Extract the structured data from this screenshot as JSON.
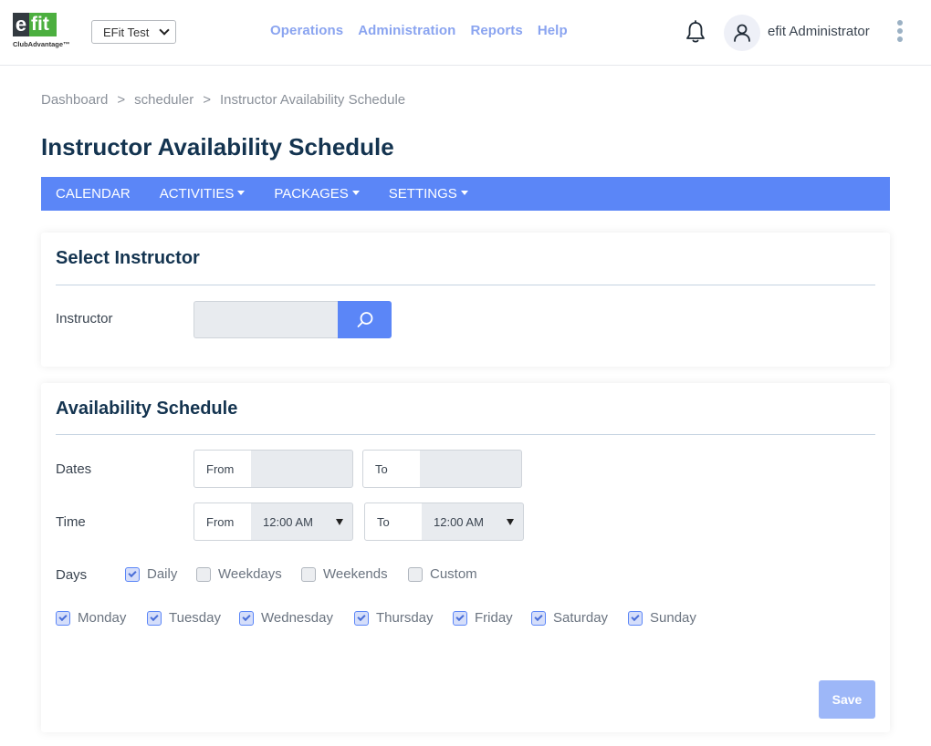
{
  "header": {
    "logo": {
      "mark_e": "e",
      "mark_fit": "fit",
      "subtitle": "ClubAdvantage™"
    },
    "club_select": {
      "value": "EFit Test"
    },
    "nav": [
      "Operations",
      "Administration",
      "Reports",
      "Help"
    ],
    "user_name": "efit Administrator",
    "icons": {
      "notifications": "bell-icon",
      "user": "user-icon",
      "more": "kebab-menu-icon"
    }
  },
  "breadcrumb": {
    "items": [
      "Dashboard",
      "scheduler",
      "Instructor Availability Schedule"
    ],
    "separator": ">"
  },
  "page_title": "Instructor Availability Schedule",
  "subnav": {
    "items": [
      {
        "label": "CALENDAR",
        "dropdown": false
      },
      {
        "label": "ACTIVITIES",
        "dropdown": true
      },
      {
        "label": "PACKAGES",
        "dropdown": true
      },
      {
        "label": "SETTINGS",
        "dropdown": true
      }
    ]
  },
  "select_instructor": {
    "title": "Select Instructor",
    "instructor_label": "Instructor",
    "instructor_value": "",
    "search_icon": "search-icon"
  },
  "availability": {
    "title": "Availability Schedule",
    "dates_label": "Dates",
    "dates_from_label": "From",
    "dates_from_value": "",
    "dates_to_label": "To",
    "dates_to_value": "",
    "time_label": "Time",
    "time_from_label": "From",
    "time_from_value": "12:00 AM",
    "time_to_label": "To",
    "time_to_value": "12:00 AM",
    "days_label": "Days",
    "presets": [
      {
        "label": "Daily",
        "checked": true
      },
      {
        "label": "Weekdays",
        "checked": false
      },
      {
        "label": "Weekends",
        "checked": false
      },
      {
        "label": "Custom",
        "checked": false
      }
    ],
    "weekdays": [
      {
        "label": "Monday",
        "checked": true
      },
      {
        "label": "Tuesday",
        "checked": true
      },
      {
        "label": "Wednesday",
        "checked": true
      },
      {
        "label": "Thursday",
        "checked": true
      },
      {
        "label": "Friday",
        "checked": true
      },
      {
        "label": "Saturday",
        "checked": true
      },
      {
        "label": "Sunday",
        "checked": true
      }
    ],
    "save_label": "Save"
  },
  "colors": {
    "accent": "#5b86f7",
    "nav_link": "#8aa4f0",
    "title": "#143450",
    "save_disabled": "#9db7f8",
    "logo_green": "#4caf3f"
  }
}
